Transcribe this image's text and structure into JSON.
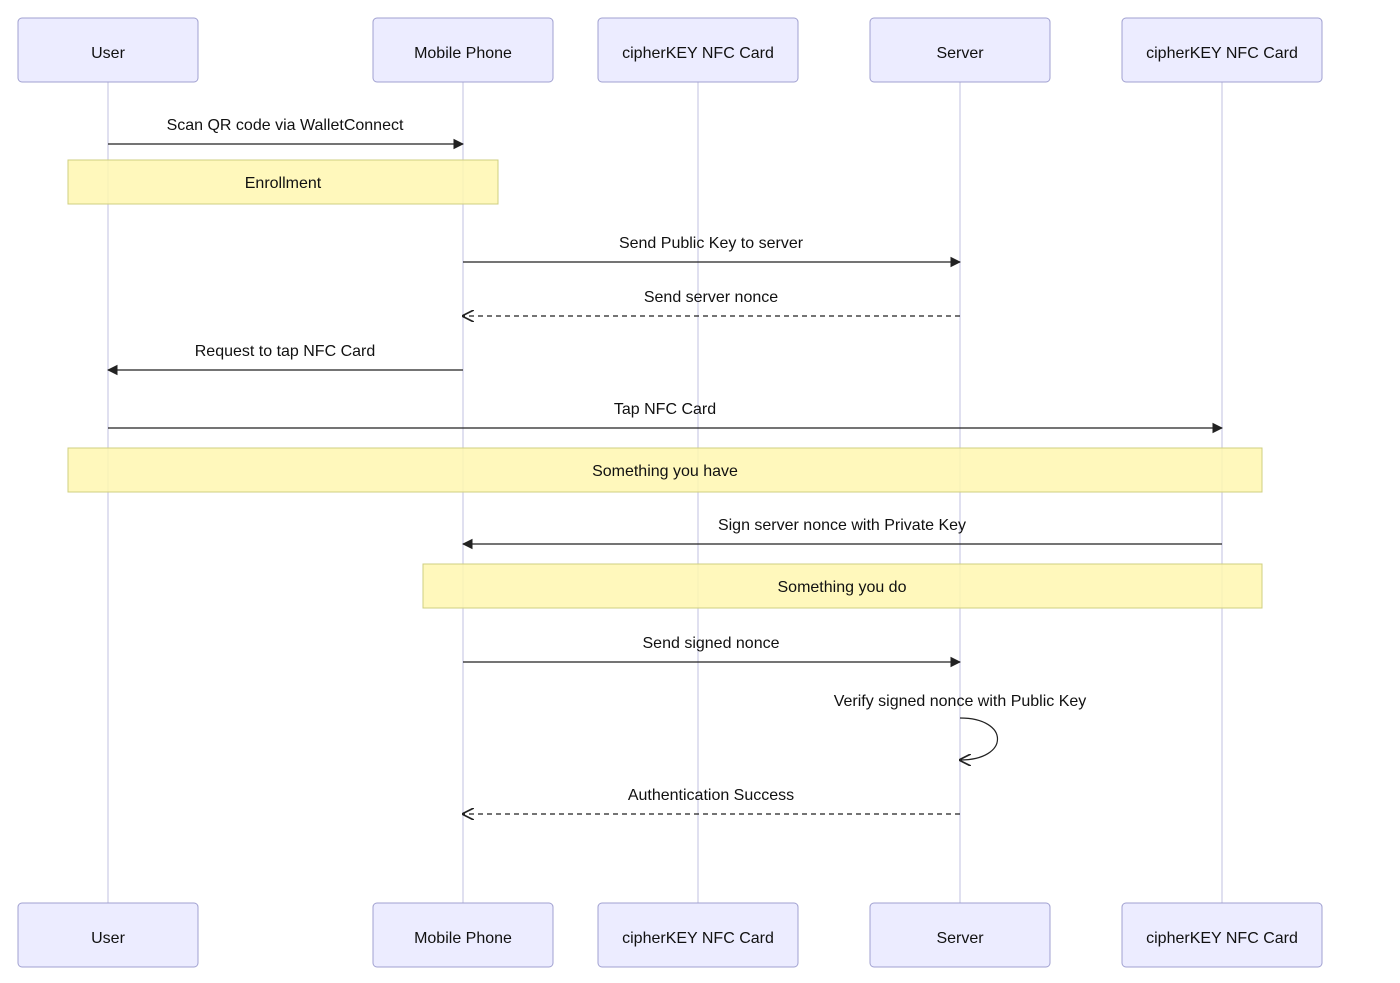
{
  "actors": {
    "user": "User",
    "mobile": "Mobile Phone",
    "nfc1": "cipherKEY NFC Card",
    "server": "Server",
    "nfc2": "cipherKEY NFC Card"
  },
  "messages": {
    "m1": "Scan QR code via WalletConnect",
    "m2": "Send Public Key to server",
    "m3": "Send server nonce",
    "m4": "Request to tap NFC Card",
    "m5": "Tap NFC Card",
    "m6": "Sign server nonce with Private Key",
    "m7": "Send signed nonce",
    "m8": "Verify signed nonce with Public Key",
    "m9": "Authentication Success"
  },
  "notes": {
    "n1": "Enrollment",
    "n2": "Something you have",
    "n3": "Something you do"
  },
  "sequence": [
    {
      "id": "m1",
      "from": "user",
      "to": "mobile",
      "style": "solid",
      "label_key": "messages.m1"
    },
    {
      "id": "n1",
      "over": [
        "user",
        "mobile"
      ],
      "label_key": "notes.n1"
    },
    {
      "id": "m2",
      "from": "mobile",
      "to": "server",
      "style": "solid",
      "label_key": "messages.m2"
    },
    {
      "id": "m3",
      "from": "server",
      "to": "mobile",
      "style": "dashed",
      "label_key": "messages.m3"
    },
    {
      "id": "m4",
      "from": "mobile",
      "to": "user",
      "style": "solid",
      "label_key": "messages.m4"
    },
    {
      "id": "m5",
      "from": "user",
      "to": "nfc2",
      "style": "solid",
      "label_key": "messages.m5"
    },
    {
      "id": "n2",
      "over": [
        "user",
        "nfc2"
      ],
      "label_key": "notes.n2"
    },
    {
      "id": "m6",
      "from": "nfc2",
      "to": "mobile",
      "style": "solid",
      "label_key": "messages.m6"
    },
    {
      "id": "n3",
      "over": [
        "mobile",
        "nfc2"
      ],
      "label_key": "notes.n3"
    },
    {
      "id": "m7",
      "from": "mobile",
      "to": "server",
      "style": "solid",
      "label_key": "messages.m7"
    },
    {
      "id": "m8",
      "from": "server",
      "to": "server",
      "style": "self",
      "label_key": "messages.m8"
    },
    {
      "id": "m9",
      "from": "server",
      "to": "mobile",
      "style": "dashed",
      "label_key": "messages.m9"
    }
  ]
}
